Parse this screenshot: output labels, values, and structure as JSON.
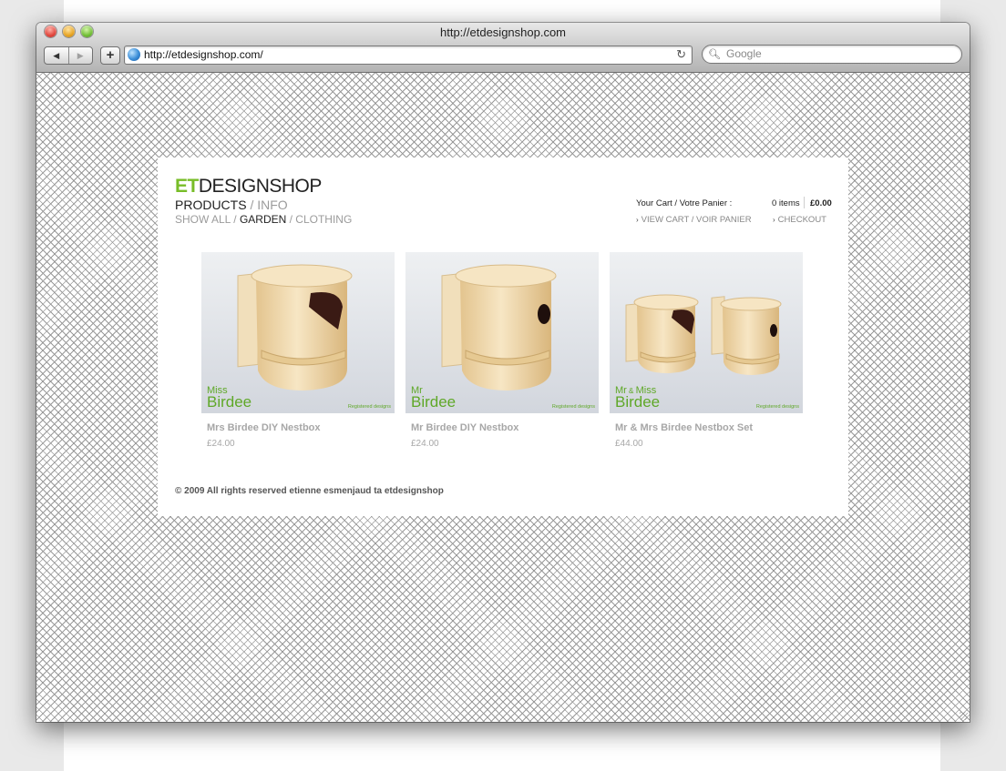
{
  "window": {
    "title": "http://etdesignshop.com"
  },
  "toolbar": {
    "back_icon": "back-arrow-icon",
    "forward_icon": "forward-arrow-icon",
    "add_label": "+",
    "url": "http://etdesignshop.com/",
    "reload_icon": "reload-icon",
    "search_placeholder": "Google"
  },
  "site": {
    "logo_et": "ET",
    "logo_rest": "DESIGNSHOP",
    "nav": {
      "products": "PRODUCTS",
      "sep": " / ",
      "info": "INFO"
    },
    "subnav": {
      "show_all": "SHOW ALL",
      "sep": " / ",
      "garden": "GARDEN",
      "clothing": "CLOTHING"
    },
    "cart": {
      "label": "Your Cart / Votre Panier :",
      "items": "0 items",
      "total": "£0.00",
      "view_cart": "VIEW CART / VOIR PANIER",
      "checkout": "CHECKOUT"
    },
    "products": [
      {
        "brand_small": "Miss",
        "brand_amp": "",
        "brand_small2": "",
        "brand_big": "Birdee",
        "registered": "Registered designs",
        "name": "Mrs Birdee DIY Nestbox",
        "price": "£24.00"
      },
      {
        "brand_small": "Mr",
        "brand_amp": "",
        "brand_small2": "",
        "brand_big": "Birdee",
        "registered": "Registered designs",
        "name": "Mr Birdee DIY Nestbox",
        "price": "£24.00"
      },
      {
        "brand_small": "Mr",
        "brand_amp": " & ",
        "brand_small2": "Miss",
        "brand_big": "Birdee",
        "registered": "Registered designs",
        "name": "Mr & Mrs Birdee Nestbox Set",
        "price": "£44.00"
      }
    ],
    "footer": "© 2009 All rights reserved etienne esmenjaud ta etdesignshop"
  },
  "colors": {
    "brand_green": "#78bd28",
    "text_dark": "#222222",
    "text_grey": "#9b9b9b"
  }
}
